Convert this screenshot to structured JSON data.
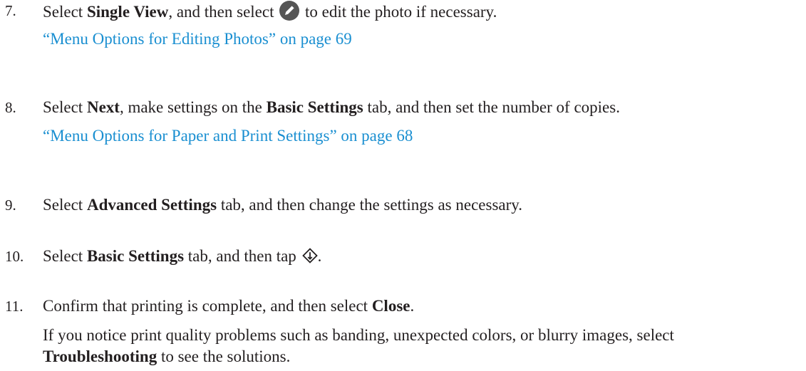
{
  "steps": [
    {
      "number": "7.",
      "pre": "Select ",
      "b1": "Single View",
      "mid": ", and then select ",
      "post": " to edit the photo if necessary.",
      "icon": "edit-icon",
      "link": "“Menu Options for Editing Photos” on page 69"
    },
    {
      "number": "8.",
      "pre": "Select ",
      "b1": "Next",
      "mid": ", make settings on the ",
      "b2": "Basic Settings",
      "post": " tab, and then set the number of copies.",
      "link": "“Menu Options for Paper and Print Settings” on page 68"
    },
    {
      "number": "9.",
      "pre": "Select ",
      "b1": "Advanced Settings",
      "post": " tab, and then change the settings as necessary."
    },
    {
      "number": "10.",
      "pre": "Select ",
      "b1": "Basic Settings",
      "post": " tab, and then tap ",
      "end": ".",
      "icon": "start-icon"
    },
    {
      "number": "11.",
      "pre": "Confirm that printing is complete, and then select ",
      "b1": "Close",
      "end": ".",
      "note_pre": "If you notice print quality problems such as banding, unexpected colors, or blurry images, select",
      "note_bold": "Troubleshooting",
      "note_post": " to see the solutions."
    }
  ],
  "colors": {
    "text": "#231f20",
    "link": "#1a8fd1",
    "icon": "#555555"
  }
}
